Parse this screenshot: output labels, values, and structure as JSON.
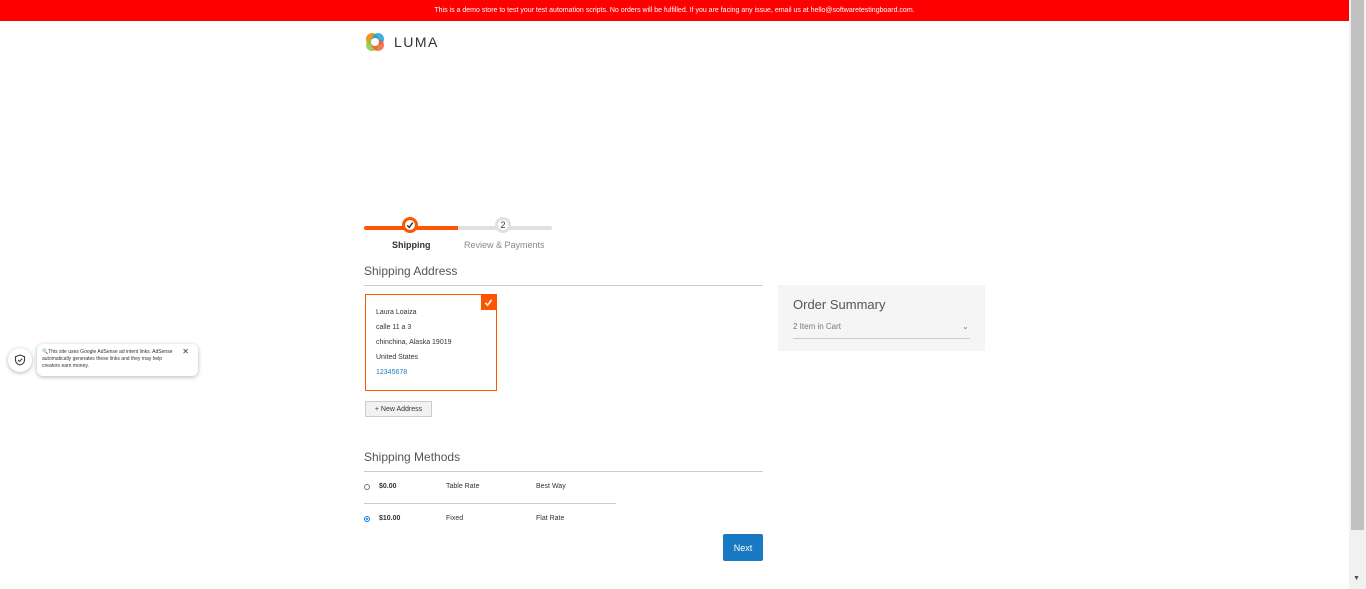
{
  "banner": {
    "text": "This is a demo store to test your test automation scripts. No orders will be fulfilled. If you are facing any issue, email us at hello@softwaretestingboard.com."
  },
  "logo": {
    "text": "LUMA"
  },
  "progress": {
    "steps": [
      {
        "label": "Shipping",
        "state": "complete"
      },
      {
        "label": "Review & Payments",
        "number": "2",
        "state": "pending"
      }
    ],
    "accent_color": "#ff5501"
  },
  "shipping_address": {
    "title": "Shipping Address",
    "card": {
      "name": "Laura Loaiza",
      "street": "calle 11 a 3",
      "city_line": "chinchina, Alaska 19019",
      "country": "United States",
      "phone": "12345678",
      "selected": true
    },
    "new_address_label": "+ New Address"
  },
  "shipping_methods": {
    "title": "Shipping Methods",
    "methods": [
      {
        "price": "$0.00",
        "title": "Table Rate",
        "carrier": "Best Way",
        "selected": false
      },
      {
        "price": "$10.00",
        "title": "Fixed",
        "carrier": "Flat Rate",
        "selected": true
      }
    ],
    "next_label": "Next"
  },
  "order_summary": {
    "title": "Order Summary",
    "items_label": "2 Item in Cart",
    "chevron": "⌄"
  },
  "adsense": {
    "tooltip": "🔍This site uses Google AdSense ad intent links. AdSense automatically generates these links and they may help creators earn money.",
    "close": "✕"
  },
  "colors": {
    "banner": "#ff0000",
    "accent": "#ff5501",
    "primary_button": "#1979c3"
  }
}
